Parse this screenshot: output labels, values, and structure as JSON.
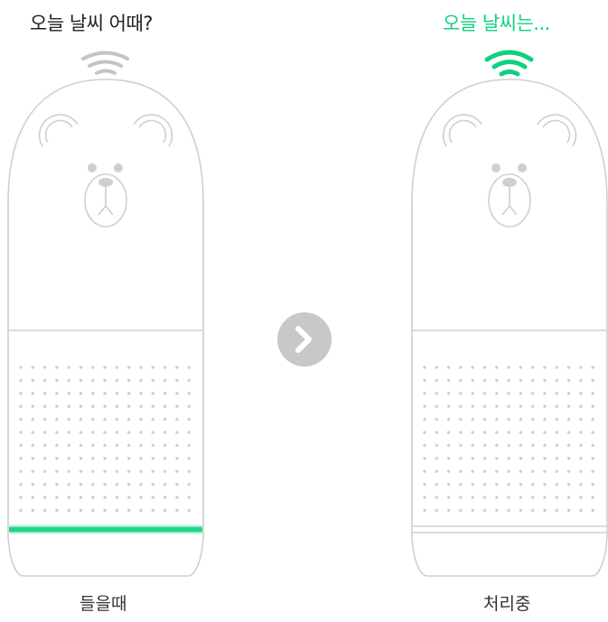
{
  "left_panel": {
    "speech": "오늘 날씨 어때?",
    "caption": "들을때",
    "speech_color": "#222222",
    "signal_color": "#c4c4c4",
    "light_bar_color": "#1fd786"
  },
  "right_panel": {
    "speech": "오늘 날씨는...",
    "caption": "처리중",
    "speech_color": "#10d17e",
    "signal_color": "#10d17e"
  },
  "arrow_icon": "chevron-right-icon",
  "colors": {
    "outline": "#cfcfcf",
    "dots": "#cfcfcf",
    "arrow_bg": "#c8c8c8"
  }
}
